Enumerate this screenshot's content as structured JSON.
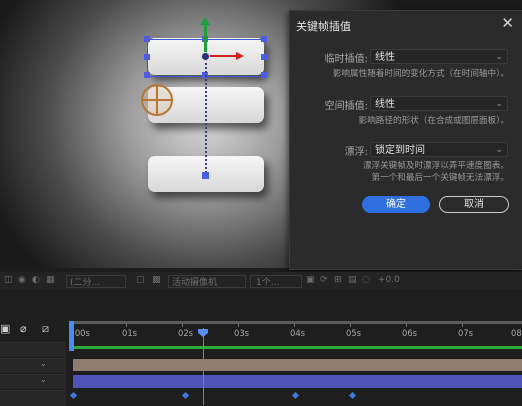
{
  "dialog": {
    "title": "关键帧插值",
    "close": "✕",
    "temporal_label": "临时插值:",
    "temporal_value": "线性",
    "temporal_desc": "影响属性随着时间的变化方式（在时间轴中）。",
    "spatial_label": "空间插值:",
    "spatial_value": "线性",
    "spatial_desc": "影响路径的形状（在合成或图层面板）。",
    "roving_label": "漂浮:",
    "roving_value": "锁定到时间",
    "roving_desc_1": "漂浮关键帧及时漂浮以弄平速度图表。",
    "roving_desc_2": "第一个和最后一个关键帧无法漂浮。",
    "ok": "确定",
    "cancel": "取消"
  },
  "toolbar": {
    "resolution": "(二分...",
    "camera": "活动摄像机",
    "views": "1个...",
    "exposure": "+0.0"
  },
  "timeline": {
    "ticks": [
      "0s",
      "01s",
      "02s",
      "03s",
      "04s",
      "05s",
      "06s",
      "07s",
      "08"
    ],
    "start_label": ":00s"
  },
  "icons": {
    "dropdown": "chevron-down-icon",
    "graph": "graph-editor-icon"
  },
  "colors": {
    "accent": "#2f6fe0",
    "selection": "#4b5ce6",
    "motion_path": "#34408a",
    "y_axis": "#1f9f3c",
    "x_axis": "#d02020",
    "tan_layer": "#8e7d70",
    "blue_layer": "#4c55b6"
  }
}
